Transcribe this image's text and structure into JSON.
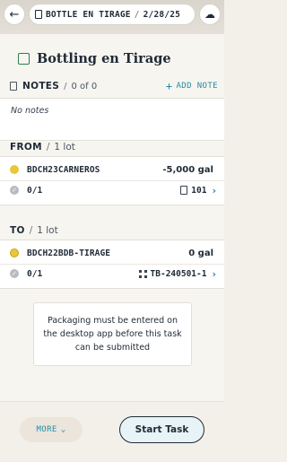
{
  "topbar": {
    "task_name": "BOTTLE EN TIRAGE",
    "date": "2/28/25"
  },
  "task": {
    "title": "Bottling en Tirage"
  },
  "notes": {
    "label": "NOTES",
    "count": "0 of 0",
    "add_label": "ADD NOTE",
    "empty_text": "No notes"
  },
  "from": {
    "label": "FROM",
    "count": "1 lot",
    "lot_code": "BDCH23CARNEROS",
    "amount": "-5,000 gal",
    "progress": "0/1",
    "vessel": "101"
  },
  "to": {
    "label": "TO",
    "count": "1 lot",
    "lot_code": "BDCH22BDB-TIRAGE",
    "amount": "0 gal",
    "progress": "0/1",
    "vessel": "TB-240501-1"
  },
  "warning": {
    "text": "Packaging must be entered on the desktop app before this task can be submitted"
  },
  "actions": {
    "more_label": "MORE",
    "start_label": "Start Task"
  },
  "colors": {
    "accent": "#1f8fa6",
    "status_yellow": "#e8c73a",
    "checkbox_green": "#2e7d4a"
  }
}
